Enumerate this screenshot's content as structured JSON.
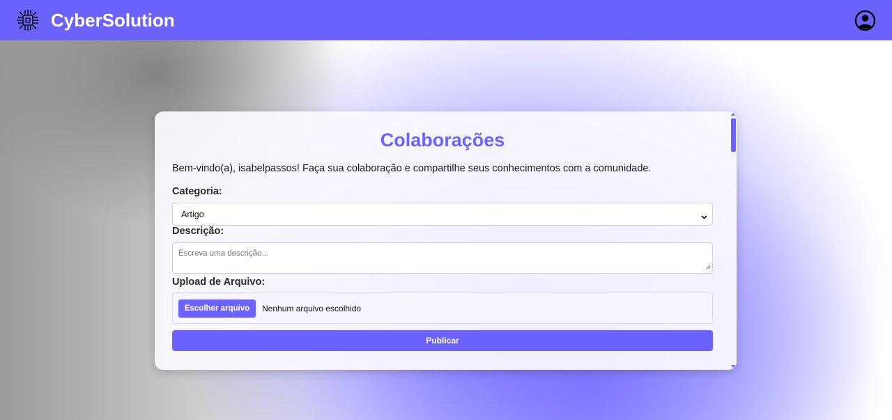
{
  "header": {
    "brand_name": "CyberSolution",
    "brand_icon": "chip-icon",
    "user_icon": "user-circle-icon",
    "background_color": "#6c63ff"
  },
  "form": {
    "title": "Colaborações",
    "welcome_text": "Bem-vindo(a), isabelpassos! Faça sua colaboração e compartilhe seus conhecimentos com a comunidade.",
    "category_label": "Categoria:",
    "category_value": "Artigo",
    "description_label": "Descrição:",
    "description_placeholder": "Escreva uma descrição...",
    "upload_label": "Upload de Arquivo:",
    "upload_button": "Escolher arquivo",
    "upload_status": "Nenhum arquivo escolhido",
    "submit_label": "Publicar"
  },
  "colors": {
    "accent": "#6c63ff"
  }
}
